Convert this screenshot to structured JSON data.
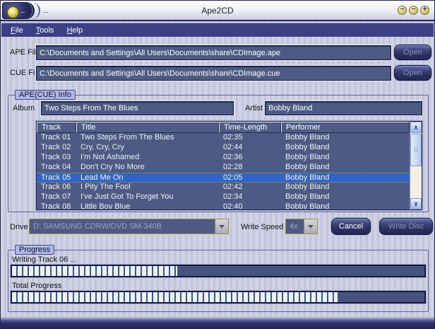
{
  "window": {
    "title": "Ape2CD",
    "titlebar": {
      "underscore_left": "_",
      "underscore_right": "_",
      "buttons": [
        {
          "name": "minimize",
          "glyph": "−"
        },
        {
          "name": "maximize",
          "glyph": "−"
        },
        {
          "name": "close",
          "glyph": "+"
        }
      ]
    },
    "menu": {
      "items": [
        {
          "label": "File"
        },
        {
          "label": "Tools"
        },
        {
          "label": "Help"
        }
      ]
    }
  },
  "file_inputs": {
    "ape": {
      "label": "APE File",
      "value": "C:\\Documents and Settings\\All Users\\Documents\\share\\CDImage.ape",
      "button": "Open"
    },
    "cue": {
      "label": "CUE File",
      "value": "C:\\Documents and Settings\\All Users\\Documents\\share\\CDImage.cue",
      "button": "Open"
    }
  },
  "info_group": {
    "title": "APE(CUE) Info",
    "album": {
      "label": "Album",
      "value": "Two Steps From The Blues"
    },
    "artist": {
      "label": "Artist",
      "value": "Bobby Bland"
    },
    "track_table": {
      "columns": [
        "Track",
        "Title",
        "Time-Length",
        "Performer"
      ],
      "rows": [
        {
          "track": "Track 01",
          "title": "Two Steps From The Blues",
          "time": "02:35",
          "performer": "Bobby Bland",
          "selected": false
        },
        {
          "track": "Track 02",
          "title": "Cry, Cry, Cry",
          "time": "02:44",
          "performer": "Bobby Bland",
          "selected": false
        },
        {
          "track": "Track 03",
          "title": "I'm Not Ashamed",
          "time": "02:36",
          "performer": "Bobby Bland",
          "selected": false
        },
        {
          "track": "Track 04",
          "title": "Don't Cry No More",
          "time": "02:28",
          "performer": "Bobby Bland",
          "selected": false
        },
        {
          "track": "Track 05",
          "title": "Lead Me On",
          "time": "02:05",
          "performer": "Bobby Bland",
          "selected": true
        },
        {
          "track": "Track 06",
          "title": "I Pity The Fool",
          "time": "02:42",
          "performer": "Bobby Bland",
          "selected": false
        },
        {
          "track": "Track 07",
          "title": "I've Just Got To Forget You",
          "time": "02:34",
          "performer": "Bobby Bland",
          "selected": false
        },
        {
          "track": "Track 08",
          "title": "Little Boy Blue",
          "time": "02:40",
          "performer": "Bobby Bland",
          "selected": false
        }
      ]
    }
  },
  "burn_controls": {
    "drive": {
      "label": "Drive",
      "value": "D: SAMSUNG CDRW/DVD SM-340B"
    },
    "write_speed": {
      "label": "Write Speed",
      "value": "4x"
    },
    "cancel_button": "Cancel",
    "write_button": "Write Disc"
  },
  "progress_group": {
    "title": "Progress",
    "current": {
      "label": "Writing Track 06 ...",
      "percent": 40
    },
    "total": {
      "label": "Total Progress",
      "percent": 79
    }
  },
  "icons": {
    "scroll_up": "∧",
    "scroll_down": "∨"
  },
  "colors": {
    "field_bg": "#4d5b84",
    "menu_bg": "#3b4084",
    "selected_row": "#2f64c8",
    "selection_marquee": "#c8981c",
    "progress_fill": "#e9f4fb",
    "titlebar_button_gold": "#d7c87a",
    "body_stripe_light": "#cfd2e4",
    "body_stripe_dark": "#c2c5d9"
  }
}
